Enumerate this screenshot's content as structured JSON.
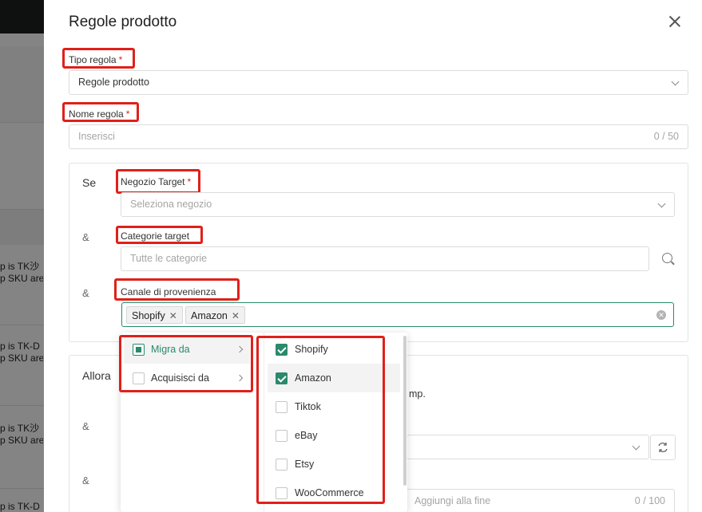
{
  "background": {
    "rows": [
      {
        "line1": "p is TK沙",
        "line2": "p SKU are"
      },
      {
        "line1": "p is TK-D",
        "line2": "p SKU are"
      },
      {
        "line1": "p is TK沙",
        "line2": "p SKU are"
      },
      {
        "line1": "p is TK-D",
        "line2": ""
      }
    ]
  },
  "drawer": {
    "title": "Regole prodotto",
    "rule_type": {
      "label": "Tipo regola",
      "value": "Regole prodotto"
    },
    "rule_name": {
      "label": "Nome regola",
      "placeholder": "Inserisci",
      "counter": "0 / 50"
    },
    "required_mark": "*",
    "condition": {
      "side_label": "Se",
      "amp": "&",
      "target_shop": {
        "label": "Negozio Target",
        "placeholder": "Seleziona negozio"
      },
      "target_categories": {
        "label": "Categorie target",
        "placeholder": "Tutte le categorie"
      },
      "source_channel": {
        "label": "Canale di provenienza",
        "tags": [
          "Shopify",
          "Amazon"
        ]
      }
    },
    "action": {
      "side_label": "Allora",
      "partial_text": "mp.",
      "append_placeholder": "Aggiungi alla fine",
      "append_counter": "0 / 100"
    }
  },
  "dropdown": {
    "first_level": [
      {
        "label": "Migra da",
        "state": "partial",
        "active": true
      },
      {
        "label": "Acquisisci da",
        "state": "unchecked",
        "active": false
      }
    ],
    "second_level": [
      {
        "label": "Shopify",
        "checked": true
      },
      {
        "label": "Amazon",
        "checked": true
      },
      {
        "label": "Tiktok",
        "checked": false
      },
      {
        "label": "eBay",
        "checked": false
      },
      {
        "label": "Etsy",
        "checked": false
      },
      {
        "label": "WooCommerce",
        "checked": false
      }
    ]
  },
  "colors": {
    "accent": "#2a8a6b",
    "highlight": "#e0201a",
    "required": "#e2231a"
  }
}
